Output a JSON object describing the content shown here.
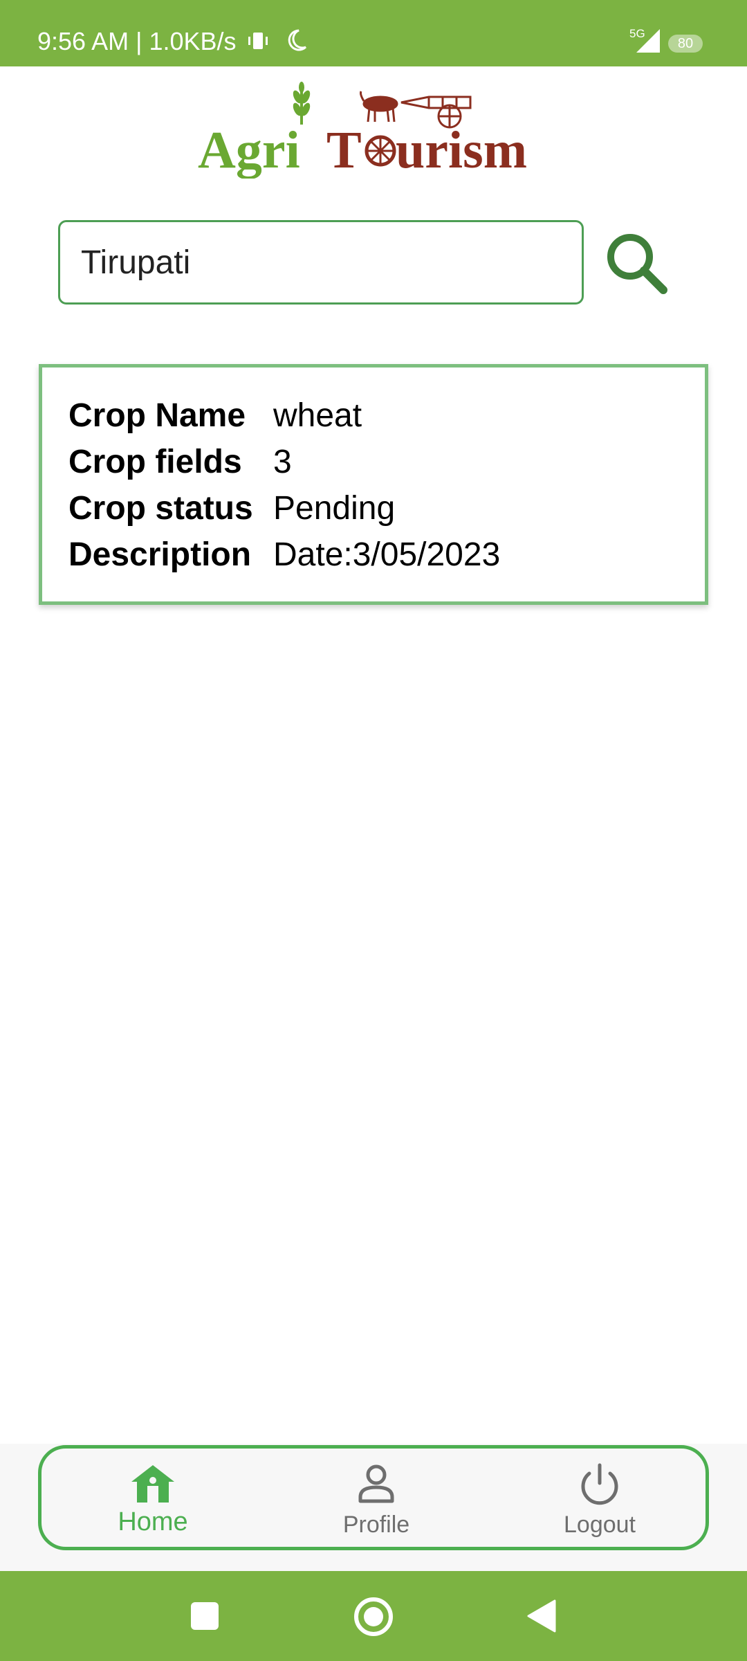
{
  "status_bar": {
    "time_speed": "9:56 AM | 1.0KB/s",
    "network": "5G",
    "battery": "80"
  },
  "logo": {
    "text_part1": "Agri",
    "text_part2": "T",
    "text_part3": "urism"
  },
  "search": {
    "value": "Tirupati",
    "icon": "search-icon"
  },
  "crop_card": {
    "rows": [
      {
        "label": "Crop Name",
        "value": "wheat"
      },
      {
        "label": "Crop fields",
        "value": "3"
      },
      {
        "label": "Crop status",
        "value": "Pending"
      },
      {
        "label": "Description",
        "value": "Date:3/05/2023"
      }
    ]
  },
  "bottom_nav": {
    "items": [
      {
        "label": "Home",
        "icon": "home-icon",
        "active": true
      },
      {
        "label": "Profile",
        "icon": "person-icon",
        "active": false
      },
      {
        "label": "Logout",
        "icon": "power-icon",
        "active": false
      }
    ]
  },
  "colors": {
    "primary_green": "#7cb342",
    "accent_green": "#4caf50",
    "logo_green": "#6aa832",
    "logo_brown": "#8b2e1f"
  }
}
